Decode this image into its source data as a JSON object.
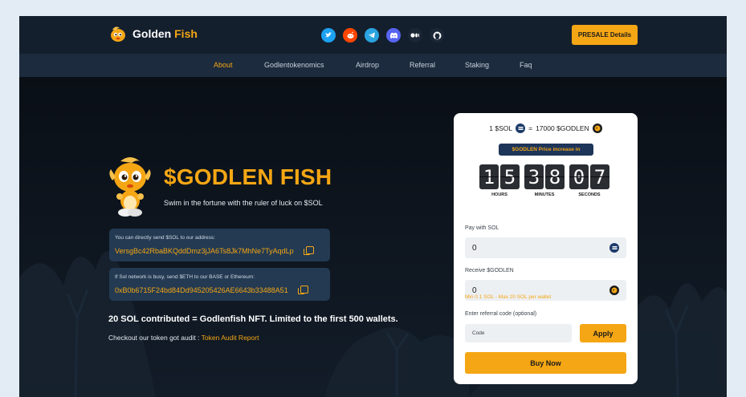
{
  "header": {
    "brand_first": "Golden",
    "brand_second": "Fish",
    "presale_label": "PRESALE Details",
    "socials": [
      {
        "icon": "twitter-icon",
        "color": "#1da1f2"
      },
      {
        "icon": "reddit-icon",
        "color": "#ff4500"
      },
      {
        "icon": "telegram-icon",
        "color": "#2aa3e0"
      },
      {
        "icon": "discord-icon",
        "color": "#5865f2"
      },
      {
        "icon": "medium-icon",
        "color": "#1b2636"
      },
      {
        "icon": "github-icon",
        "color": "#1b2636"
      }
    ]
  },
  "nav": {
    "items": [
      "About",
      "Godlentokenomics",
      "Airdrop",
      "Referral",
      "Staking",
      "Faq"
    ],
    "active": "About"
  },
  "hero": {
    "title": "$GODLEN FISH",
    "subtitle": "Swim in the fortune with the ruler of luck on $SOL",
    "sol_label": "You can directly send $SOL to our address:",
    "sol_address": "VersgBc42RbaBKQddDmz3jJA6Ts8Jk7MhNe7TyAqdLp",
    "eth_label": "If Sol network is busy, send $ETH to our BASE or Ethereum:",
    "eth_address": "0xB0b6715F24bd84Dd945205426AE6643b33488A51",
    "nft_note": "20 SOL contributed = Godlenfish NFT. Limited to the first 500 wallets.",
    "audit_text": "Checkout our token got audit : ",
    "audit_link": "Token Audit Report"
  },
  "widget": {
    "rate_left": "1 $SOL",
    "rate_eq": "=",
    "rate_right": "17000 $GODLEN",
    "price_notice": "$GODLEN Price increase in",
    "timer": {
      "hours": "15",
      "minutes": "38",
      "seconds": "07",
      "hours_label": "HOURS",
      "minutes_label": "MINUTES",
      "seconds_label": "SECONDS"
    },
    "pay_label": "Pay with SOL",
    "pay_value": "0",
    "receive_label": "Receive $GODLEN",
    "receive_value": "0",
    "limits": "Min 0.1 SOL - Max 20 SOL per wallet",
    "referral_label": "Enter referral code (optional)",
    "referral_placeholder": "Code",
    "apply_label": "Apply",
    "buy_label": "Buy Now"
  },
  "colors": {
    "accent": "#f5a614",
    "background": "#0c121b",
    "header": "#141f2d",
    "nav": "#1c2b3d"
  }
}
